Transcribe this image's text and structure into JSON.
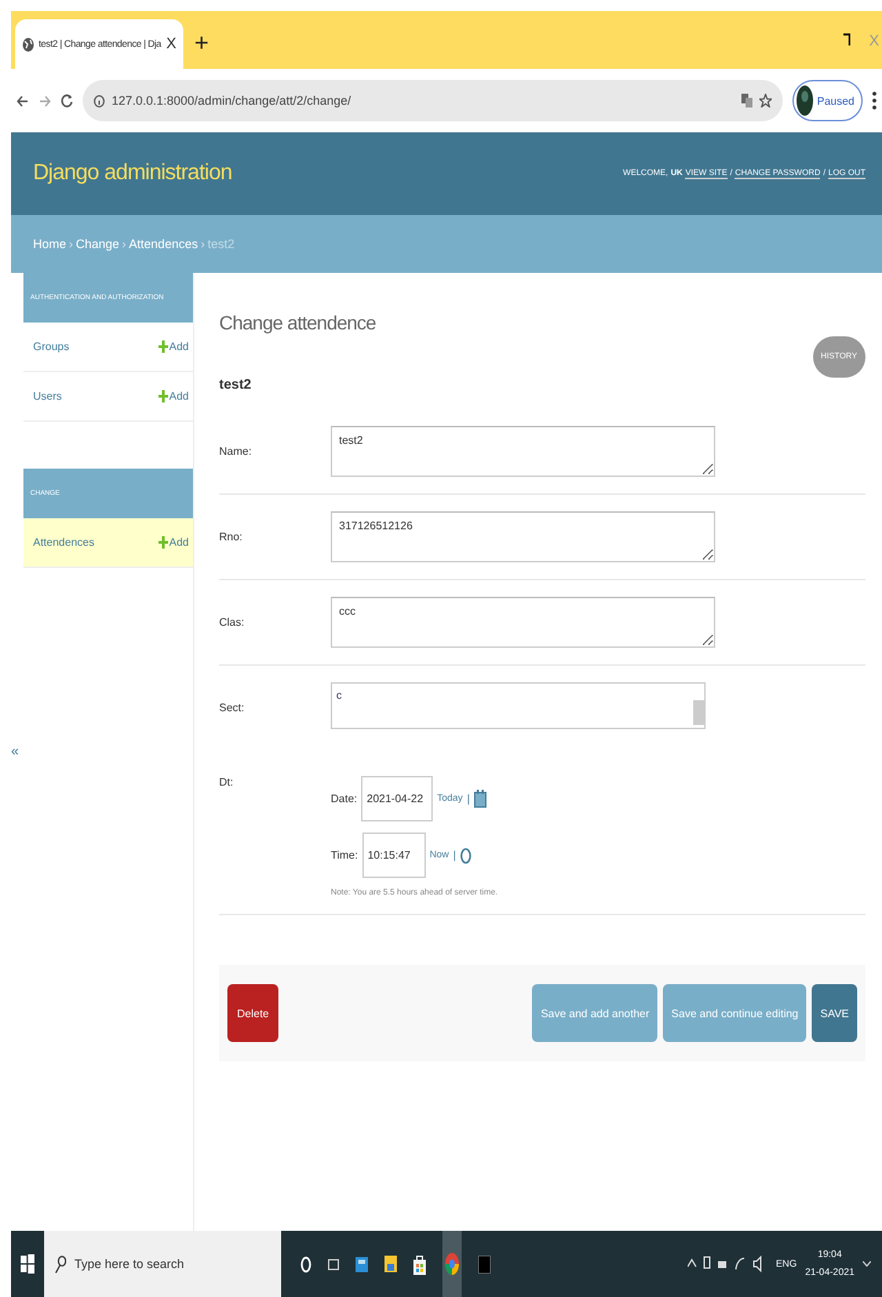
{
  "browser": {
    "tab_title": "test2 | Change attendence | Dja",
    "tab_close": "X",
    "new_tab": "+",
    "window_close": "X",
    "address": "127.0.0.1:8000/admin/change/att/2/change/",
    "profile": "Paused"
  },
  "header": {
    "brand": "Django administration",
    "welcome": "WELCOME, ",
    "user": "UK",
    "link_separator": "/",
    "links": [
      "VIEW SITE",
      "CHANGE PASSWORD",
      "LOG OUT"
    ]
  },
  "breadcrumbs": {
    "separator": "›",
    "links": [
      "Home",
      "Change",
      "Attendences"
    ],
    "current": "test2"
  },
  "sidebar": {
    "toggle": "«",
    "modules": [
      {
        "caption": "AUTHENTICATION AND AUTHORIZATION",
        "items": [
          {
            "label": "Groups",
            "add": "Add",
            "selected": false
          },
          {
            "label": "Users",
            "add": "Add",
            "selected": false
          }
        ]
      },
      {
        "caption": "CHANGE",
        "items": [
          {
            "label": "Attendences",
            "add": "Add",
            "selected": true
          }
        ]
      }
    ]
  },
  "content": {
    "title": "Change attendence",
    "history": "HISTORY",
    "object": "test2",
    "fields": [
      {
        "kind": "textarea",
        "label": "Name:",
        "value": "test2"
      },
      {
        "kind": "textarea",
        "label": "Rno:",
        "value": "317126512126"
      },
      {
        "kind": "textarea",
        "label": "Clas:",
        "value": "ccc"
      },
      {
        "kind": "select",
        "label": "Sect:",
        "value": "c"
      },
      {
        "kind": "datetime",
        "label": "Dt:",
        "date_label": "Date:",
        "date": "2021-04-22",
        "today": "Today",
        "divider": "|",
        "time_label": "Time:",
        "time": "10:15:47",
        "now": "Now",
        "note": "Note: You are 5.5 hours ahead of server time."
      }
    ]
  },
  "actions": {
    "delete": "Delete",
    "buttons": [
      {
        "label": "Save and add another",
        "kind": "secondary"
      },
      {
        "label": "Save and continue editing",
        "kind": "secondary"
      },
      {
        "label": "SAVE",
        "kind": "default"
      }
    ]
  },
  "taskbar": {
    "search_placeholder": "Type here to search",
    "language": "ENG",
    "time": "19:04",
    "date": "21-04-2021"
  }
}
